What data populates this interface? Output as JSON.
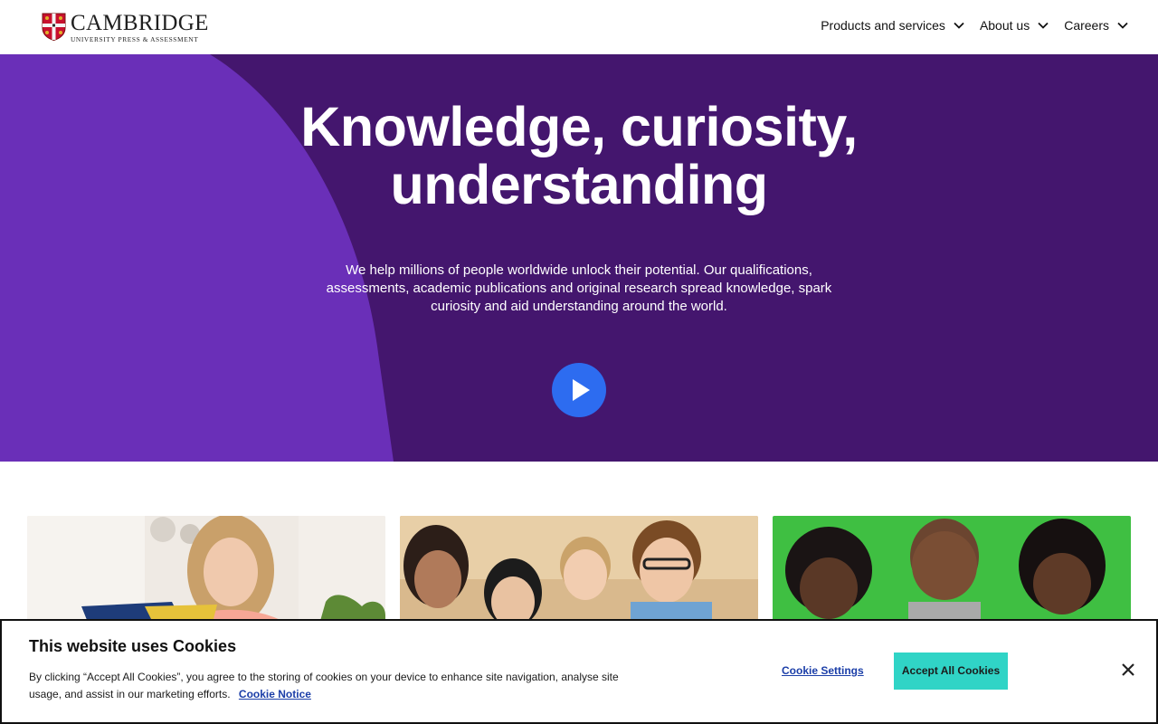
{
  "header": {
    "logo_name": "CAMBRIDGE",
    "logo_sub": "UNIVERSITY PRESS & ASSESSMENT",
    "nav": [
      {
        "label": "Products and services"
      },
      {
        "label": "About us"
      },
      {
        "label": "Careers"
      }
    ]
  },
  "hero": {
    "title_line1": "Knowledge, curiosity,",
    "title_line2": "understanding",
    "text": "We help millions of people worldwide unlock their potential. Our qualifications, assessments, academic publications and original research spread knowledge, spark curiosity and aid understanding around the world.",
    "colors": {
      "background": "#44166e",
      "shape": "#6a2fb8",
      "play": "#2d6cf0"
    }
  },
  "cards": [
    {
      "image": "woman-reading-book-photo"
    },
    {
      "image": "group-of-students-photo"
    },
    {
      "image": "children-on-green-background-photo"
    }
  ],
  "cookie_banner": {
    "title": "This website uses Cookies",
    "text": "By clicking “Accept All Cookies”, you agree to the storing of cookies on your device to enhance site navigation, analyse site usage, and assist in our marketing efforts.",
    "notice_link": "Cookie Notice",
    "settings_label": "Cookie Settings",
    "accept_label": "Accept All Cookies",
    "close_icon": "close-icon",
    "colors": {
      "accept": "#30d4c6",
      "link": "#1b3ea8"
    }
  }
}
